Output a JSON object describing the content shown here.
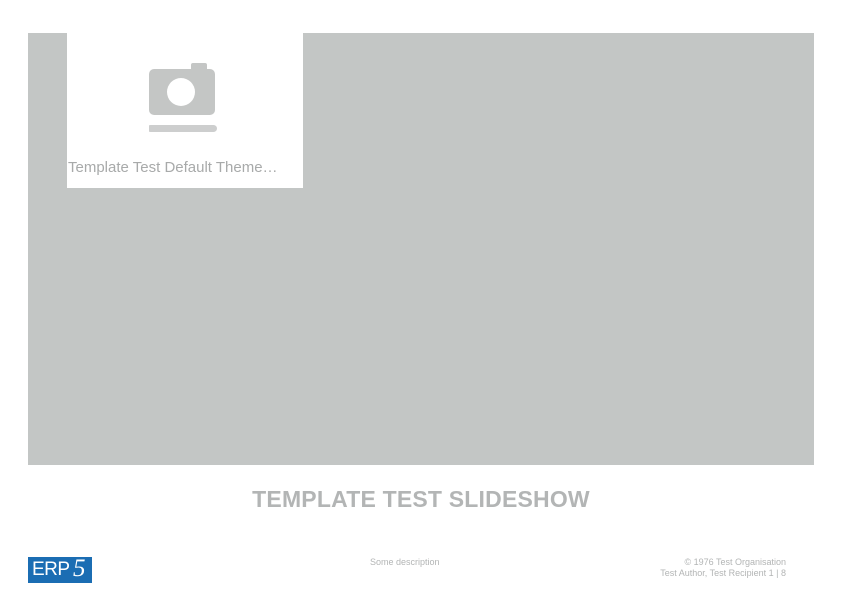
{
  "slide": {
    "logo_caption": "Template Test Default Theme…",
    "title": "TEMPLATE TEST SLIDESHOW"
  },
  "footer": {
    "brand": "ERP",
    "brand_number": "5",
    "description": "Some description",
    "copyright": "© 1976  Test Organisation",
    "authors": "Test Author, Test Recipient",
    "page": "1 | 8"
  },
  "colors": {
    "cover_background": "#c3c6c5",
    "brand_blue": "#1b6db3",
    "muted_text": "#b3b5b5"
  },
  "icons": {
    "placeholder": "camera-icon"
  }
}
